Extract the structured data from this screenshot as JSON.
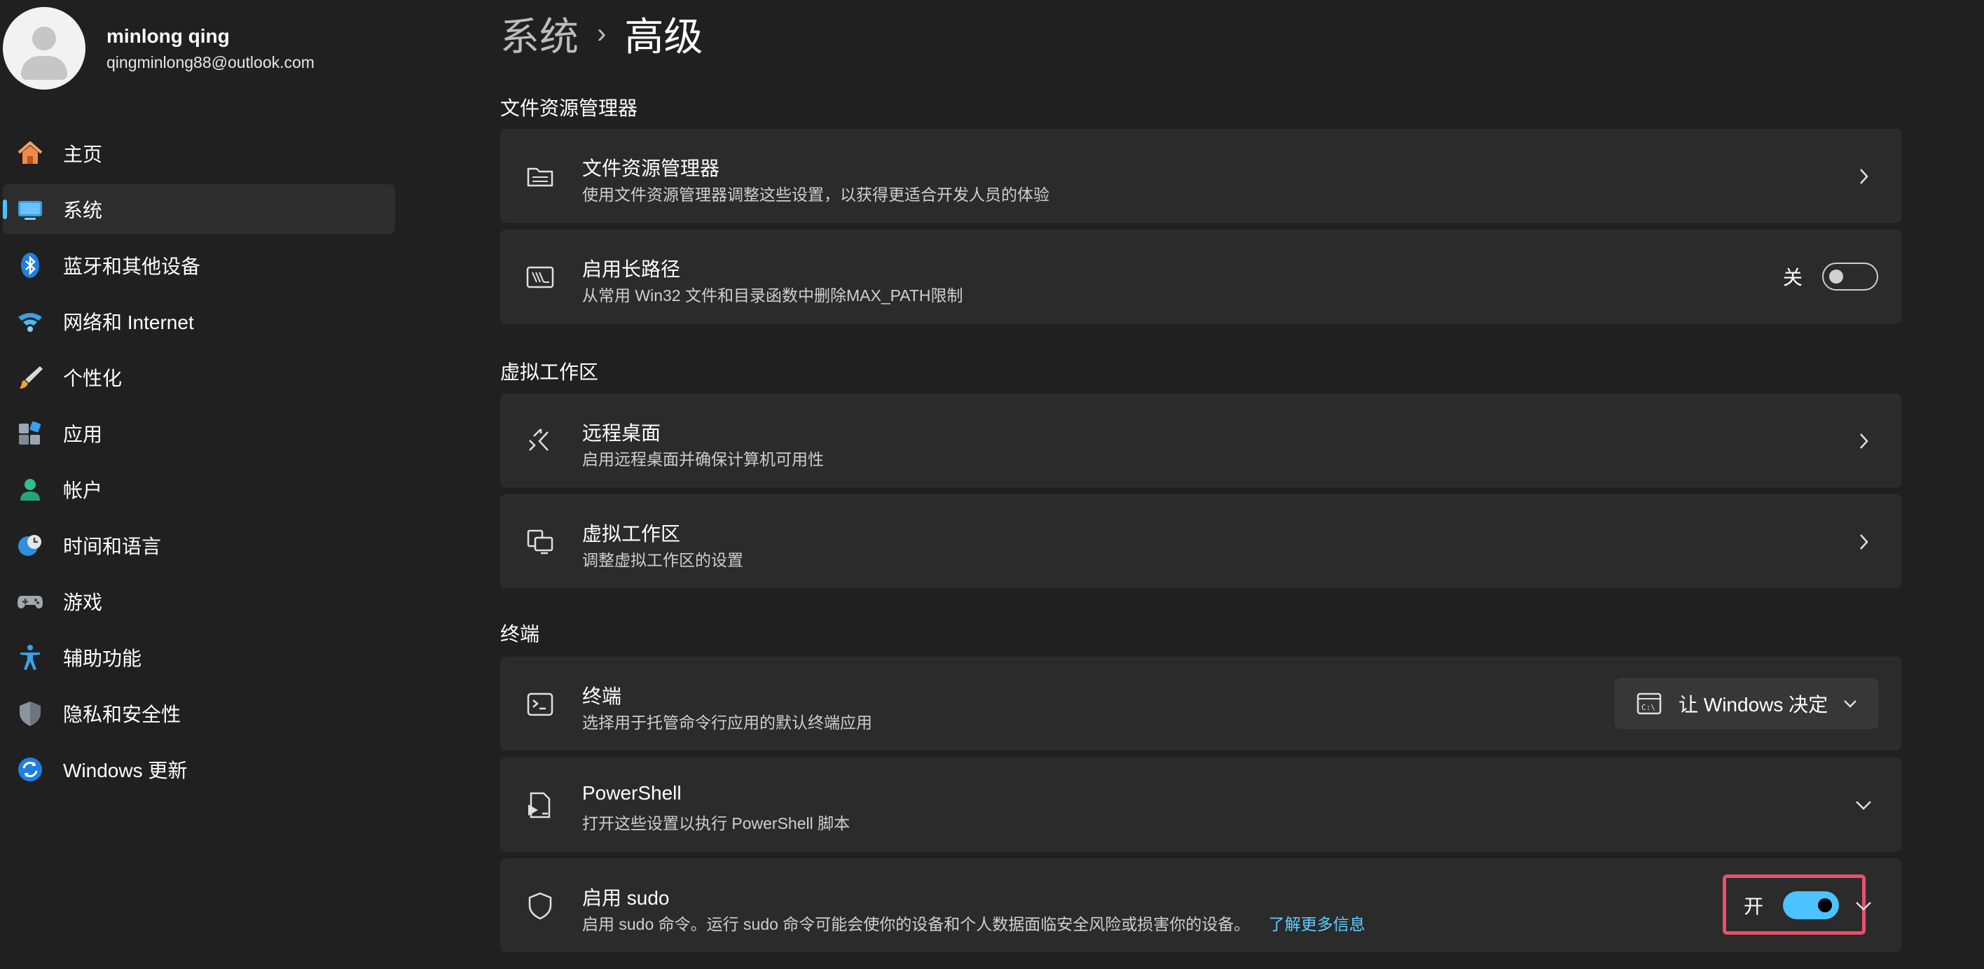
{
  "user": {
    "name": "minlong qing",
    "email": "qingminlong88@outlook.com"
  },
  "nav": {
    "items": [
      {
        "label": "主页",
        "icon": "home-icon"
      },
      {
        "label": "系统",
        "icon": "system-icon",
        "active": true
      },
      {
        "label": "蓝牙和其他设备",
        "icon": "bluetooth-icon"
      },
      {
        "label": "网络和 Internet",
        "icon": "wifi-icon"
      },
      {
        "label": "个性化",
        "icon": "brush-icon"
      },
      {
        "label": "应用",
        "icon": "apps-icon"
      },
      {
        "label": "帐户",
        "icon": "account-icon"
      },
      {
        "label": "时间和语言",
        "icon": "time-language-icon"
      },
      {
        "label": "游戏",
        "icon": "gamepad-icon"
      },
      {
        "label": "辅助功能",
        "icon": "accessibility-icon"
      },
      {
        "label": "隐私和安全性",
        "icon": "shield-icon"
      },
      {
        "label": "Windows 更新",
        "icon": "windows-update-icon"
      }
    ]
  },
  "breadcrumb": {
    "parent": "系统",
    "separator": "›",
    "current": "高级"
  },
  "sections": {
    "file_explorer": {
      "title": "文件资源管理器",
      "cards": {
        "explorer": {
          "title": "文件资源管理器",
          "desc": "使用文件资源管理器调整这些设置，以获得更适合开发人员的体验",
          "icon": "folder-icon"
        },
        "long_paths": {
          "title": "启用长路径",
          "desc": "从常用 Win32 文件和目录函数中删除MAX_PATH限制",
          "icon": "long-path-icon",
          "toggle_label": "关",
          "toggle_state": "off"
        }
      }
    },
    "virtual_workspaces": {
      "title": "虚拟工作区",
      "cards": {
        "remote_desktop": {
          "title": "远程桌面",
          "desc": "启用远程桌面并确保计算机可用性",
          "icon": "remote-desktop-icon"
        },
        "virtual_workspace": {
          "title": "虚拟工作区",
          "desc": "调整虚拟工作区的设置",
          "icon": "virtual-workspace-icon"
        }
      }
    },
    "terminal": {
      "title": "终端",
      "cards": {
        "terminal": {
          "title": "终端",
          "desc": "选择用于托管命令行应用的默认终端应用",
          "icon": "terminal-icon",
          "dropdown_value": "让 Windows 决定"
        },
        "powershell": {
          "title": "PowerShell",
          "desc": "打开这些设置以执行 PowerShell 脚本",
          "icon": "powershell-icon"
        },
        "sudo": {
          "title": "启用 sudo",
          "desc": "启用 sudo 命令。运行 sudo 命令可能会使你的设备和个人数据面临安全风险或损害你的设备。",
          "link": "了解更多信息",
          "icon": "shield-outline-icon",
          "toggle_label": "开",
          "toggle_state": "on"
        }
      }
    }
  },
  "colors": {
    "background": "#202020",
    "card": "#2b2b2b",
    "accent": "#4cc2ff",
    "link": "#60cdff",
    "highlight": "#e9506a"
  }
}
